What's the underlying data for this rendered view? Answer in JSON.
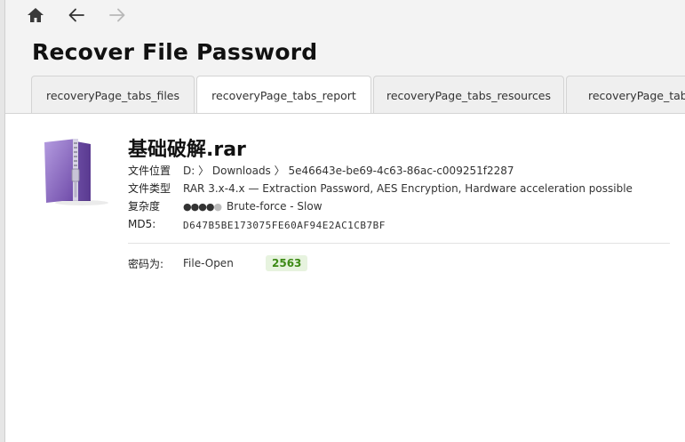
{
  "window": {
    "title": "Recover File Password"
  },
  "nav": {
    "home_icon": "home-icon",
    "back_icon": "arrow-left-icon",
    "forward_icon": "arrow-right-icon"
  },
  "tabs": [
    {
      "label": "recoveryPage_tabs_files"
    },
    {
      "label": "recoveryPage_tabs_report",
      "active": true
    },
    {
      "label": "recoveryPage_tabs_resources"
    },
    {
      "label": "recoveryPage_tabs_"
    }
  ],
  "file": {
    "name": "基础破解.rar",
    "icon": "archive-file-icon",
    "location_label": "文件位置",
    "location_value": "D: 〉 Downloads 〉 5e46643e-be69-4c63-86ac-c009251f2287",
    "type_label": "文件类型",
    "type_value": "RAR 3.x-4.x — Extraction Password, AES Encryption, Hardware acceleration possible",
    "complexity_label": "复杂度",
    "complexity_level": 4,
    "complexity_max": 5,
    "complexity_text": "Brute-force - Slow",
    "md5_label": "MD5:",
    "md5_value": "D647B5BE173075FE60AF94E2AC1CB7BF"
  },
  "password": {
    "label": "密码为:",
    "method": "File-Open",
    "value": "2563"
  },
  "colors": {
    "accent_green": "#3d8a16",
    "badge_bg": "#e7f3df",
    "icon_purple": "#7d5ab5"
  }
}
